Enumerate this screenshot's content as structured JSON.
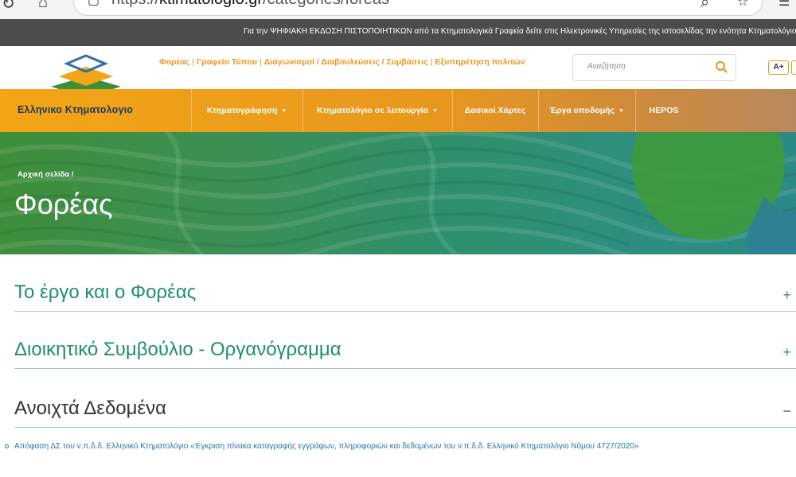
{
  "browser": {
    "url_prefix": "https://",
    "url_host": "ktimatologio.gr",
    "url_path": "/categories/foreas"
  },
  "announcement": {
    "text": "Για την ΨΗΦΙΑΚΗ ΕΚΔΟΣΗ ΠΙΣΤΟΠΟΙΗΤΙΚΩΝ από τα Κτηματολογικά Γραφεία δείτε στις Ηλεκτρονικές Υπηρεσίες της ιστοσελίδας την ενότητα Κτηματολόγιο σε λειτουργία"
  },
  "toplinks": [
    {
      "label": "Φορέας"
    },
    {
      "label": "Γραφείο Τύπου"
    },
    {
      "label": "Διαγωνισμοί / Διαβουλεύσεις / Συμβάσεις"
    },
    {
      "label": "Εξυπηρέτηση πολιτών"
    }
  ],
  "search": {
    "placeholder": "Αναζήτηση"
  },
  "accessibility": {
    "font_increase_label": "A+"
  },
  "brand": {
    "name": "Ελληνικο Κτηματολογιο"
  },
  "nav": {
    "items": [
      {
        "label": "Κτηματογράφηση",
        "has_dropdown": true
      },
      {
        "label": "Κτηματολόγιο σε λειτουργία",
        "has_dropdown": true
      },
      {
        "label": "Δασικοί Χάρτες",
        "has_dropdown": false
      },
      {
        "label": "Έργα υποδομής",
        "has_dropdown": true
      },
      {
        "label": "HEPOS",
        "has_dropdown": false
      }
    ],
    "caret_glyph": "▼"
  },
  "hero": {
    "breadcrumb_home": "Αρχική σελίδα",
    "breadcrumb_sep": "/",
    "title": "Φορέας"
  },
  "sections": [
    {
      "title": "Το έργο και ο Φορέας",
      "state": "collapsed",
      "toggle": "+"
    },
    {
      "title": "Διοικητικό Συμβούλιο - Οργανόγραμμα",
      "state": "collapsed",
      "toggle": "+"
    },
    {
      "title": "Ανοιχτά Δεδομένα",
      "state": "expanded",
      "toggle": "−"
    }
  ],
  "open_data_items": [
    {
      "text": "Απόφαση ΔΣ του ν.π.δ.δ. Ελληνικό Κτηματολόγιο «Έγκριση πίνακα καταγραφής εγγράφων, πληροφοριών και δεδομένων του ν.π.δ.δ. Ελληνικό Κτηματολόγιο Νόμου 4727/2020»"
    }
  ],
  "colors": {
    "accent_orange": "#e8961c",
    "brand_navy": "#1d3a5c",
    "section_green": "#1f8f6a",
    "link_blue": "#2a6fb0",
    "announce_bg": "#4c4c4c"
  }
}
